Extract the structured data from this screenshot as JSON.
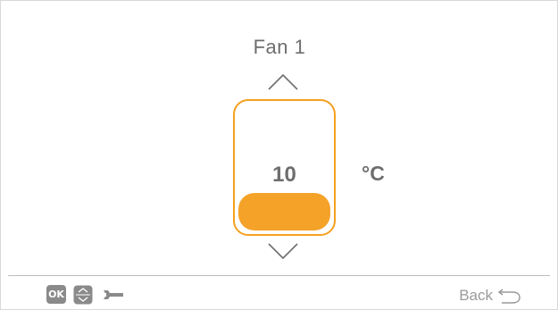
{
  "screen": {
    "title": "Fan 1"
  },
  "setpoint": {
    "value": "10",
    "unit": "°C",
    "fill_fraction": 0.3
  },
  "footer": {
    "ok_label": "OK",
    "back_label": "Back",
    "icons": [
      "ok-key-icon",
      "up-down-nav-icon",
      "wrench-icon",
      "back-arrow-icon"
    ]
  },
  "colors": {
    "accent": "#f5a229",
    "text": "#6e6e6e",
    "muted": "#9a9a9a",
    "divider": "#bdbdbd"
  }
}
